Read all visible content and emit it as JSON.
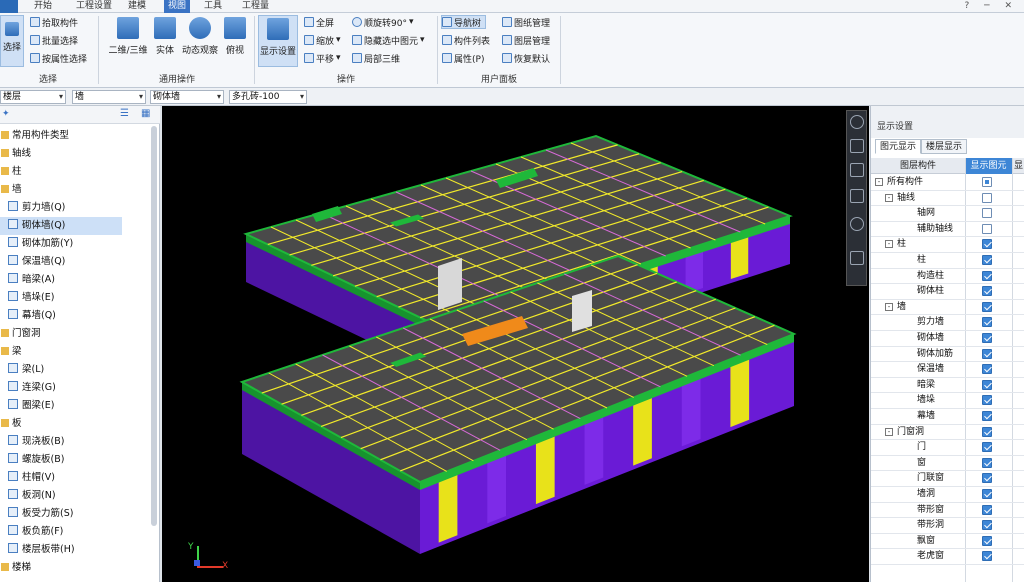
{
  "menubar": {
    "items": [
      {
        "label": "开始",
        "active": false
      },
      {
        "label": "工程设置",
        "active": false
      },
      {
        "label": "建模",
        "active": false
      },
      {
        "label": "视图",
        "active": true
      },
      {
        "label": "工具",
        "active": false
      },
      {
        "label": "工程量",
        "active": false
      }
    ],
    "window_controls": "? ─ ✕"
  },
  "ribbon": {
    "select_group": {
      "select_label": "选择",
      "pick": "拾取构件",
      "batch": "批量选择",
      "by_attr": "按属性选择",
      "group_label": "选择"
    },
    "general_group": {
      "view2d3d": "二维/三维",
      "solid": "实体",
      "dynamic": "动态观察",
      "top": "俯视",
      "group_label": "通用操作"
    },
    "ops_group": {
      "display_settings": "显示设置",
      "fullscreen": "全屏",
      "zoom": "缩放",
      "pan": "平移",
      "rotate": "顺旋转90°",
      "hide_sel": "隐藏选中图元",
      "local3d": "局部三维",
      "group_label": "操作"
    },
    "panel_group": {
      "nav_tree": "导航树",
      "comp_list": "构件列表",
      "props": "属性(P)",
      "drawing_mgr": "图纸管理",
      "layer_mgr": "图层管理",
      "restore": "恢复默认",
      "group_label": "用户面板"
    }
  },
  "propbar": {
    "floor": "楼层",
    "type": "墙",
    "subtype": "砌体墙",
    "spec": "多孔砖-100"
  },
  "nav_tree": {
    "rows": [
      {
        "label": "常用构件类型",
        "kind": "folder",
        "indent": 0,
        "selected": false
      },
      {
        "label": "轴线",
        "kind": "folder",
        "indent": 0,
        "selected": false
      },
      {
        "label": "柱",
        "kind": "folder",
        "indent": 0,
        "selected": false
      },
      {
        "label": "墙",
        "kind": "folder",
        "indent": 0,
        "selected": false
      },
      {
        "label": "剪力墙(Q)",
        "kind": "item",
        "indent": 1,
        "selected": false
      },
      {
        "label": "砌体墙(Q)",
        "kind": "item",
        "indent": 1,
        "selected": true
      },
      {
        "label": "砌体加筋(Y)",
        "kind": "item",
        "indent": 1,
        "selected": false
      },
      {
        "label": "保温墙(Q)",
        "kind": "item",
        "indent": 1,
        "selected": false
      },
      {
        "label": "暗梁(A)",
        "kind": "item",
        "indent": 1,
        "selected": false
      },
      {
        "label": "墙垛(E)",
        "kind": "item",
        "indent": 1,
        "selected": false
      },
      {
        "label": "幕墙(Q)",
        "kind": "item",
        "indent": 1,
        "selected": false
      },
      {
        "label": "门窗洞",
        "kind": "folder",
        "indent": 0,
        "selected": false
      },
      {
        "label": "梁",
        "kind": "folder",
        "indent": 0,
        "selected": false
      },
      {
        "label": "梁(L)",
        "kind": "item",
        "indent": 1,
        "selected": false
      },
      {
        "label": "连梁(G)",
        "kind": "item",
        "indent": 1,
        "selected": false
      },
      {
        "label": "圈梁(E)",
        "kind": "item",
        "indent": 1,
        "selected": false
      },
      {
        "label": "板",
        "kind": "folder",
        "indent": 0,
        "selected": false
      },
      {
        "label": "现浇板(B)",
        "kind": "item",
        "indent": 1,
        "selected": false
      },
      {
        "label": "螺旋板(B)",
        "kind": "item",
        "indent": 1,
        "selected": false
      },
      {
        "label": "柱帽(V)",
        "kind": "item",
        "indent": 1,
        "selected": false
      },
      {
        "label": "板洞(N)",
        "kind": "item",
        "indent": 1,
        "selected": false
      },
      {
        "label": "板受力筋(S)",
        "kind": "item",
        "indent": 1,
        "selected": false
      },
      {
        "label": "板负筋(F)",
        "kind": "item",
        "indent": 1,
        "selected": false
      },
      {
        "label": "楼层板带(H)",
        "kind": "item",
        "indent": 1,
        "selected": false
      },
      {
        "label": "楼梯",
        "kind": "folder",
        "indent": 0,
        "selected": false
      }
    ]
  },
  "viewport": {
    "axis_x": "X",
    "axis_y": "Y"
  },
  "display_panel": {
    "title": "显示设置",
    "tabs": [
      {
        "label": "图元显示",
        "active": true
      },
      {
        "label": "楼层显示",
        "active": false
      }
    ],
    "col_component": "图层构件",
    "col_show": "显示图元",
    "col_name": "显",
    "rows": [
      {
        "label": "所有构件",
        "level": 0,
        "expander": "-",
        "state": "part"
      },
      {
        "label": "轴线",
        "level": 1,
        "expander": "-",
        "state": "off"
      },
      {
        "label": "轴网",
        "level": 2,
        "expander": "",
        "state": "off"
      },
      {
        "label": "辅助轴线",
        "level": 2,
        "expander": "",
        "state": "off"
      },
      {
        "label": "柱",
        "level": 1,
        "expander": "-",
        "state": "on"
      },
      {
        "label": "柱",
        "level": 2,
        "expander": "",
        "state": "on"
      },
      {
        "label": "构造柱",
        "level": 2,
        "expander": "",
        "state": "on"
      },
      {
        "label": "砌体柱",
        "level": 2,
        "expander": "",
        "state": "on"
      },
      {
        "label": "墙",
        "level": 1,
        "expander": "-",
        "state": "on"
      },
      {
        "label": "剪力墙",
        "level": 2,
        "expander": "",
        "state": "on"
      },
      {
        "label": "砌体墙",
        "level": 2,
        "expander": "",
        "state": "on"
      },
      {
        "label": "砌体加筋",
        "level": 2,
        "expander": "",
        "state": "on"
      },
      {
        "label": "保温墙",
        "level": 2,
        "expander": "",
        "state": "on"
      },
      {
        "label": "暗梁",
        "level": 2,
        "expander": "",
        "state": "on"
      },
      {
        "label": "墙垛",
        "level": 2,
        "expander": "",
        "state": "on"
      },
      {
        "label": "幕墙",
        "level": 2,
        "expander": "",
        "state": "on"
      },
      {
        "label": "门窗洞",
        "level": 1,
        "expander": "-",
        "state": "on"
      },
      {
        "label": "门",
        "level": 2,
        "expander": "",
        "state": "on"
      },
      {
        "label": "窗",
        "level": 2,
        "expander": "",
        "state": "on"
      },
      {
        "label": "门联窗",
        "level": 2,
        "expander": "",
        "state": "on"
      },
      {
        "label": "墙洞",
        "level": 2,
        "expander": "",
        "state": "on"
      },
      {
        "label": "带形窗",
        "level": 2,
        "expander": "",
        "state": "on"
      },
      {
        "label": "带形洞",
        "level": 2,
        "expander": "",
        "state": "on"
      },
      {
        "label": "飘窗",
        "level": 2,
        "expander": "",
        "state": "on"
      },
      {
        "label": "老虎窗",
        "level": 2,
        "expander": "",
        "state": "on"
      }
    ]
  },
  "colors": {
    "accent": "#3d86d6",
    "slab": "#4a4a4a",
    "wall_purple": "#6a1bd6",
    "beam_green": "#1fb83a",
    "column_yellow": "#e8e21a",
    "edge_yellow": "#f2ea2a"
  },
  "icons": [
    "folder-icon",
    "wall-icon",
    "beam-icon",
    "slab-icon",
    "checkbox-icon",
    "rotate-icon",
    "cube-icon",
    "view-icon"
  ]
}
